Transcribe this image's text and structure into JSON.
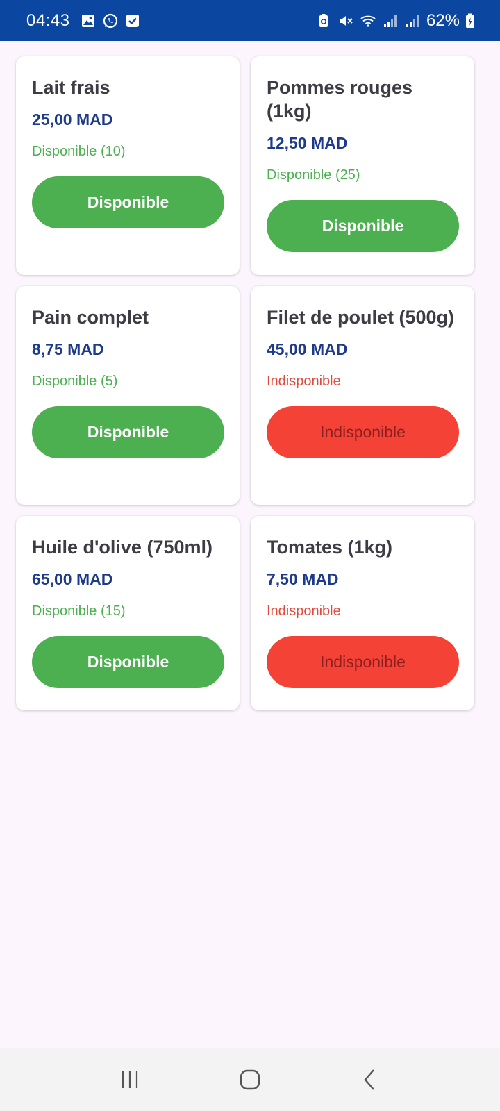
{
  "status_bar": {
    "time": "04:43",
    "battery": "62%",
    "left_icons": [
      "gallery-icon",
      "whatsapp-icon",
      "checkbox-notification-icon"
    ],
    "right_icons": [
      "battery-saver-icon",
      "mute-icon",
      "wifi-icon",
      "signal-icon",
      "signal-icon"
    ]
  },
  "products": [
    {
      "name": "Lait frais",
      "price": "25,00 MAD",
      "stock": "Disponible (10)",
      "button": "Disponible",
      "available": true
    },
    {
      "name": "Pommes rouges (1kg)",
      "price": "12,50 MAD",
      "stock": "Disponible (25)",
      "button": "Disponible",
      "available": true
    },
    {
      "name": "Pain complet",
      "price": "8,75 MAD",
      "stock": "Disponible (5)",
      "button": "Disponible",
      "available": true
    },
    {
      "name": "Filet de poulet (500g)",
      "price": "45,00 MAD",
      "stock": "Indisponible",
      "button": "Indisponible",
      "available": false
    },
    {
      "name": "Huile d'olive (750ml)",
      "price": "65,00 MAD",
      "stock": "Disponible (15)",
      "button": "Disponible",
      "available": true
    },
    {
      "name": "Tomates (1kg)",
      "price": "7,50 MAD",
      "stock": "Indisponible",
      "button": "Indisponible",
      "available": false
    }
  ],
  "colors": {
    "status_bar": "#0b47a1",
    "available": "#4caf50",
    "unavailable": "#f44336",
    "price": "#1e3a8a"
  },
  "nav_bar": {
    "buttons": [
      "recent-apps-icon",
      "home-icon",
      "back-icon"
    ]
  }
}
